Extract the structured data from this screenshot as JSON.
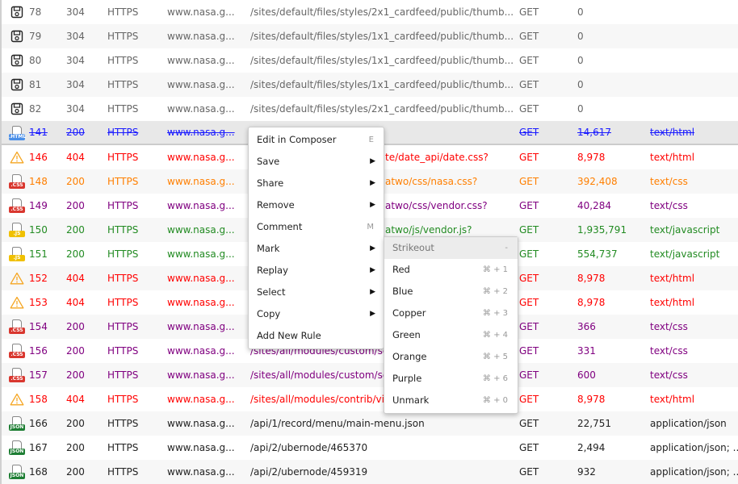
{
  "rows": [
    {
      "id": "78",
      "status": "304",
      "protocol": "HTTPS",
      "host": "www.nasa.g...",
      "path": "/sites/default/files/styles/2x1_cardfeed/public/thumb...",
      "method": "GET",
      "size": "0",
      "type": "",
      "color": "grey",
      "icon": "save-icon"
    },
    {
      "id": "79",
      "status": "304",
      "protocol": "HTTPS",
      "host": "www.nasa.g...",
      "path": "/sites/default/files/styles/1x1_cardfeed/public/thumb...",
      "method": "GET",
      "size": "0",
      "type": "",
      "color": "grey",
      "icon": "save-icon"
    },
    {
      "id": "80",
      "status": "304",
      "protocol": "HTTPS",
      "host": "www.nasa.g...",
      "path": "/sites/default/files/styles/1x1_cardfeed/public/thumb...",
      "method": "GET",
      "size": "0",
      "type": "",
      "color": "grey",
      "icon": "save-icon"
    },
    {
      "id": "81",
      "status": "304",
      "protocol": "HTTPS",
      "host": "www.nasa.g...",
      "path": "/sites/default/files/styles/1x1_cardfeed/public/thumb...",
      "method": "GET",
      "size": "0",
      "type": "",
      "color": "grey",
      "icon": "save-icon"
    },
    {
      "id": "82",
      "status": "304",
      "protocol": "HTTPS",
      "host": "www.nasa.g...",
      "path": "/sites/default/files/styles/2x1_cardfeed/public/thumb...",
      "method": "GET",
      "size": "0",
      "type": "",
      "color": "grey",
      "icon": "save-icon"
    },
    {
      "id": "141",
      "status": "200",
      "protocol": "HTTPS",
      "host": "www.nasa.g...",
      "path": "",
      "method": "GET",
      "size": "14,617",
      "type": "text/html",
      "color": "blue",
      "icon": "html-file-icon",
      "selected": true
    },
    {
      "id": "146",
      "status": "404",
      "protocol": "HTTPS",
      "host": "www.nasa.g...",
      "path": "te/date_api/date.css?",
      "method": "GET",
      "size": "8,978",
      "type": "text/html",
      "color": "red",
      "icon": "warning-icon",
      "offset": true
    },
    {
      "id": "148",
      "status": "200",
      "protocol": "HTTPS",
      "host": "www.nasa.g...",
      "path": "atwo/css/nasa.css?",
      "method": "GET",
      "size": "392,408",
      "type": "text/css",
      "color": "orange",
      "icon": "css-file-icon",
      "offset": true
    },
    {
      "id": "149",
      "status": "200",
      "protocol": "HTTPS",
      "host": "www.nasa.g...",
      "path": "atwo/css/vendor.css?",
      "method": "GET",
      "size": "40,284",
      "type": "text/css",
      "color": "purple",
      "icon": "css-file-icon",
      "offset": true
    },
    {
      "id": "150",
      "status": "200",
      "protocol": "HTTPS",
      "host": "www.nasa.g...",
      "path": "atwo/js/vendor.js?",
      "method": "GET",
      "size": "1,935,791",
      "type": "text/javascript",
      "color": "green",
      "icon": "js-file-icon",
      "offset": true
    },
    {
      "id": "151",
      "status": "200",
      "protocol": "HTTPS",
      "host": "www.nasa.g...",
      "path": "",
      "method": "GET",
      "size": "554,737",
      "type": "text/javascript",
      "color": "green",
      "icon": "js-file-icon"
    },
    {
      "id": "152",
      "status": "404",
      "protocol": "HTTPS",
      "host": "www.nasa.g...",
      "path": "",
      "method": "GET",
      "size": "8,978",
      "type": "text/html",
      "color": "red",
      "icon": "warning-icon"
    },
    {
      "id": "153",
      "status": "404",
      "protocol": "HTTPS",
      "host": "www.nasa.g...",
      "path": "",
      "method": "GET",
      "size": "8,978",
      "type": "text/html",
      "color": "red",
      "icon": "warning-icon"
    },
    {
      "id": "154",
      "status": "200",
      "protocol": "HTTPS",
      "host": "www.nasa.g...",
      "path": "",
      "method": "GET",
      "size": "366",
      "type": "text/css",
      "color": "purple",
      "icon": "css-file-icon"
    },
    {
      "id": "156",
      "status": "200",
      "protocol": "HTTPS",
      "host": "www.nasa.g...",
      "path": "/sites/all/modules/custom/sca",
      "method": "GET",
      "size": "331",
      "type": "text/css",
      "color": "purple",
      "icon": "css-file-icon"
    },
    {
      "id": "157",
      "status": "200",
      "protocol": "HTTPS",
      "host": "www.nasa.g...",
      "path": "/sites/all/modules/custom/sca",
      "method": "GET",
      "size": "600",
      "type": "text/css",
      "color": "purple",
      "icon": "css-file-icon"
    },
    {
      "id": "158",
      "status": "404",
      "protocol": "HTTPS",
      "host": "www.nasa.g...",
      "path": "/sites/all/modules/contrib/vie",
      "method": "GET",
      "size": "8,978",
      "type": "text/html",
      "color": "red",
      "icon": "warning-icon"
    },
    {
      "id": "166",
      "status": "200",
      "protocol": "HTTPS",
      "host": "www.nasa.g...",
      "path": "/api/1/record/menu/main-menu.json",
      "method": "GET",
      "size": "22,751",
      "type": "application/json",
      "color": "black",
      "icon": "json-file-icon"
    },
    {
      "id": "167",
      "status": "200",
      "protocol": "HTTPS",
      "host": "www.nasa.g...",
      "path": "/api/2/ubernode/465370",
      "method": "GET",
      "size": "2,494",
      "type": "application/json; ...",
      "color": "black",
      "icon": "json-file-icon"
    },
    {
      "id": "168",
      "status": "200",
      "protocol": "HTTPS",
      "host": "www.nasa.g...",
      "path": "/api/2/ubernode/459319",
      "method": "GET",
      "size": "932",
      "type": "application/json; ...",
      "color": "black",
      "icon": "json-file-icon"
    }
  ],
  "file_icon_labels": {
    "html-file-icon": ".HTML",
    "css-file-icon": ".CSS",
    "js-file-icon": ".JS",
    "json-file-icon": "JSON"
  },
  "file_icon_colors": {
    "html-file-icon": "#4a8fe8",
    "css-file-icon": "#d9372f",
    "js-file-icon": "#f0c000",
    "json-file-icon": "#1e7e34",
    "warning": "#f5a623"
  },
  "context_menu": [
    {
      "label": "Edit in Composer",
      "shortcut": "E"
    },
    {
      "label": "Save",
      "submenu": true
    },
    {
      "label": "Share",
      "submenu": true
    },
    {
      "label": "Remove",
      "submenu": true
    },
    {
      "label": "Comment",
      "shortcut": "M"
    },
    {
      "label": "Mark",
      "submenu": true
    },
    {
      "label": "Replay",
      "submenu": true
    },
    {
      "label": "Select",
      "submenu": true
    },
    {
      "label": "Copy",
      "submenu": true
    },
    {
      "label": "Add New Rule"
    }
  ],
  "mark_submenu": [
    {
      "label": "Strikeout",
      "shortcut": "-",
      "disabled": true
    },
    {
      "label": "Red",
      "shortcut": "⌘ + 1"
    },
    {
      "label": "Blue",
      "shortcut": "⌘ + 2"
    },
    {
      "label": "Copper",
      "shortcut": "⌘ + 3"
    },
    {
      "label": "Green",
      "shortcut": "⌘ + 4"
    },
    {
      "label": "Orange",
      "shortcut": "⌘ + 5"
    },
    {
      "label": "Purple",
      "shortcut": "⌘ + 6"
    },
    {
      "label": "Unmark",
      "shortcut": "⌘ + 0"
    }
  ]
}
